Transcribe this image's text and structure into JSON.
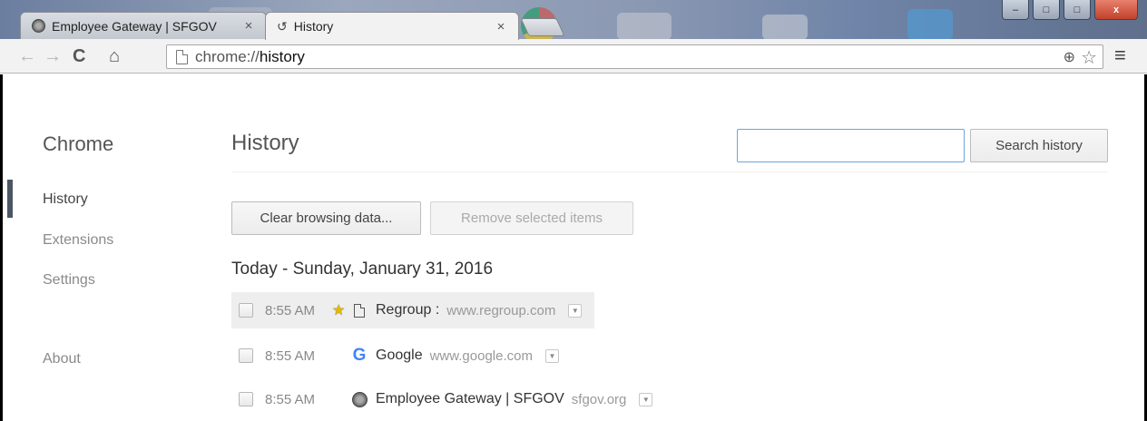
{
  "window": {
    "minimize_label": "–",
    "maximize_label": "□",
    "close_label": "x"
  },
  "tabs": [
    {
      "title": "Employee Gateway | SFGOV",
      "close": "×",
      "active": false
    },
    {
      "title": "History",
      "close": "×",
      "active": true
    }
  ],
  "toolbar": {
    "back_icon": "←",
    "forward_icon": "→",
    "reload_icon": "C",
    "home_icon": "⌂",
    "url_scheme": "chrome://",
    "url_host": "history",
    "zoom_icon": "⊕",
    "bookmark_icon": "☆",
    "menu_icon": "≡"
  },
  "sidebar": {
    "brand": "Chrome",
    "items": [
      {
        "label": "History",
        "selected": true
      },
      {
        "label": "Extensions",
        "selected": false
      },
      {
        "label": "Settings",
        "selected": false
      },
      {
        "label": "About",
        "selected": false
      }
    ]
  },
  "main": {
    "title": "History",
    "search_value": "",
    "search_button": "Search history",
    "clear_button": "Clear browsing data...",
    "remove_button": "Remove selected items",
    "day_heading": "Today - Sunday, January 31, 2016"
  },
  "entries": [
    {
      "time": "8:55 AM",
      "starred": true,
      "favicon": "page-icon",
      "title": "Regroup : ",
      "domain": "www.regroup.com"
    },
    {
      "time": "8:55 AM",
      "starred": false,
      "favicon": "google-icon",
      "title": "Google",
      "domain": "www.google.com"
    },
    {
      "time": "8:55 AM",
      "starred": false,
      "favicon": "sfgov-seal-icon",
      "title": "Employee Gateway | SFGOV",
      "domain": "sfgov.org"
    }
  ],
  "colors": {
    "search_focus_border": "#6ea3d8",
    "google_blue": "#4285f4",
    "star_yellow": "#e6b800"
  }
}
